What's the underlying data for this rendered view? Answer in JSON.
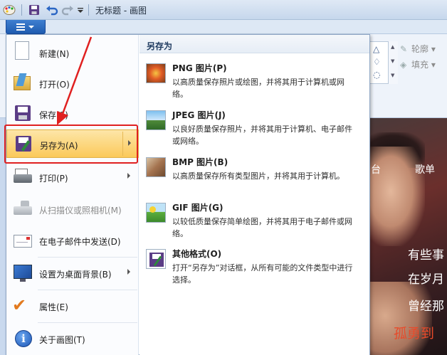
{
  "window": {
    "title": "无标题 - 画图"
  },
  "quick_access": {
    "save_icon": "floppy-save-icon",
    "undo_icon": "undo-icon",
    "redo_icon": "redo-icon",
    "customize_icon": "dropdown-arrow-icon"
  },
  "app_menu": {
    "button_icon": "app-menu-icon",
    "items": [
      {
        "label": "新建(N)",
        "icon": "new-document-icon",
        "enabled": true,
        "submenu": false
      },
      {
        "label": "打开(O)",
        "icon": "open-folder-icon",
        "enabled": true,
        "submenu": false
      },
      {
        "label": "保存(S)",
        "icon": "save-floppy-icon",
        "enabled": true,
        "submenu": false
      },
      {
        "label": "另存为(A)",
        "icon": "save-as-icon",
        "enabled": true,
        "submenu": true,
        "highlighted": true
      },
      {
        "label": "打印(P)",
        "icon": "printer-icon",
        "enabled": true,
        "submenu": true
      },
      {
        "label": "从扫描仪或照相机(M)",
        "icon": "scanner-icon",
        "enabled": false,
        "submenu": false
      },
      {
        "label": "在电子邮件中发送(D)",
        "icon": "email-icon",
        "enabled": true,
        "submenu": false
      },
      {
        "label": "设置为桌面背景(B)",
        "icon": "desktop-background-icon",
        "enabled": true,
        "submenu": true
      },
      {
        "label": "属性(E)",
        "icon": "checkmark-icon",
        "enabled": true,
        "submenu": false
      },
      {
        "label": "关于画图(T)",
        "icon": "info-icon",
        "enabled": true,
        "submenu": false
      }
    ]
  },
  "save_as_panel": {
    "title": "另存为",
    "items": [
      {
        "title": "PNG 图片(P)",
        "description": "以高质量保存照片或绘图，并将其用于计算机或网络。",
        "icon": "png-image-icon"
      },
      {
        "title": "JPEG 图片(J)",
        "description": "以良好质量保存照片，并将其用于计算机、电子邮件或网络。",
        "icon": "jpeg-image-icon"
      },
      {
        "title": "BMP 图片(B)",
        "description": "以高质量保存所有类型图片，并将其用于计算机。",
        "icon": "bmp-image-icon"
      },
      {
        "title": "GIF 图片(G)",
        "description": "以较低质量保存简单绘图，并将其用于电子邮件或网络。",
        "icon": "gif-image-icon"
      },
      {
        "title": "其他格式(O)",
        "description": "打开“另存为”对话框，从所有可能的文件类型中进行选择。",
        "icon": "other-format-icon"
      }
    ]
  },
  "ribbon": {
    "outline_label": "轮廓",
    "fill_label": "填充"
  },
  "canvas_texts": {
    "tai": "台",
    "gedan": "歌单",
    "line1": "有些事",
    "line2": "在岁月",
    "line3": "曾经那",
    "line4": "孤勇到"
  },
  "colors": {
    "highlight": "#fbc95a",
    "annotation": "#e02020",
    "app_button": "#1f5cb0"
  }
}
